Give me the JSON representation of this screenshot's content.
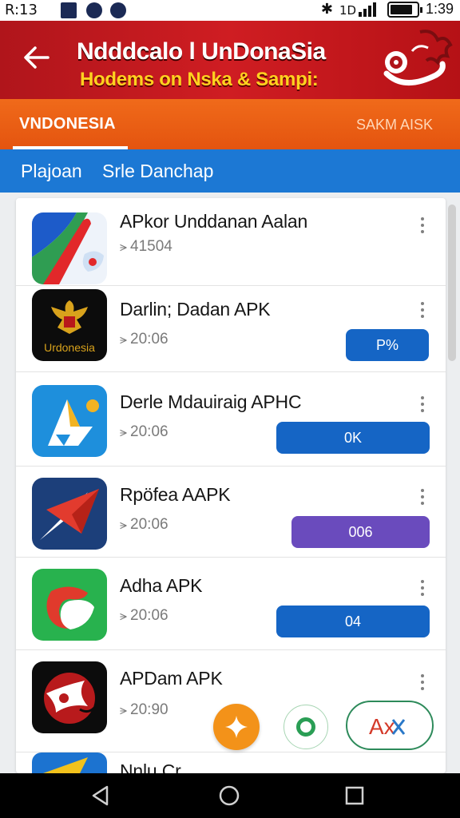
{
  "status_bar": {
    "left_text": "R:13",
    "time": "1:39",
    "battery_level": 0.85
  },
  "banner": {
    "title": "Ndddcalo l UnDonaSia",
    "subtitle": "Hodems on Nska & Sampi:",
    "background": "#c4181d",
    "subtitle_color": "#ffd21f"
  },
  "tabs": {
    "active": "VNDONESIA",
    "inactive": "SAKM AISK",
    "color": "#ea5d12"
  },
  "subbar": {
    "item1": "Plajoan",
    "item2": "Srle Danchap",
    "color": "#1c78d4"
  },
  "apps": [
    {
      "name": "APkor Unddanan Aalan",
      "meta": "41504",
      "icon": "red-arrow-blue-app-icon",
      "button": ""
    },
    {
      "name": "Darlin; Dadan APK",
      "meta": "20:06",
      "icon": "garuda-indonesia-icon",
      "icon_label": "Urdonesia",
      "button": "P%"
    },
    {
      "name": "Derle Mdauiraig APHC",
      "meta": "20:06",
      "icon": "blue-triangle-app-icon",
      "button": "0K"
    },
    {
      "name": "Rpöfea AAPK",
      "meta": "20:06",
      "icon": "red-paper-plane-icon",
      "button": "006"
    },
    {
      "name": "Adha APK",
      "meta": "20:06",
      "icon": "green-red-swirl-icon",
      "button": "04"
    },
    {
      "name": "APDam APK",
      "meta": "20:90",
      "icon": "red-mask-emblem-icon",
      "button": ""
    },
    {
      "name": "Nnlu Cr",
      "meta": "",
      "icon": "blue-arrow-partial-icon",
      "button": ""
    }
  ],
  "fabs": {
    "star": "star-icon",
    "ring": "ring-icon",
    "pill": "Ax"
  },
  "colors": {
    "button_blue": "#1565c5",
    "button_purple": "#6a4bbd",
    "fab_orange": "#f39219",
    "green": "#2a9e55"
  }
}
